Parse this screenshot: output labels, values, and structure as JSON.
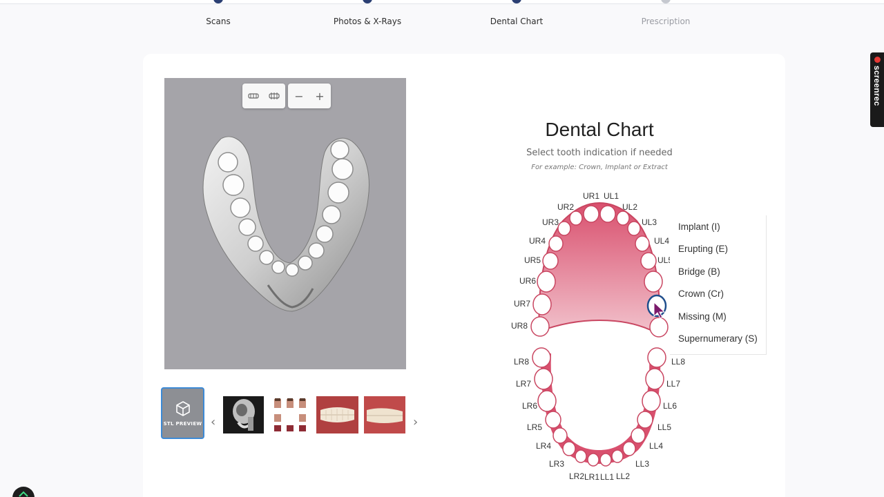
{
  "steps": [
    {
      "label": "Scans",
      "state": "active"
    },
    {
      "label": "Photos & X-Rays",
      "state": "active"
    },
    {
      "label": "Dental Chart",
      "state": "active"
    },
    {
      "label": "Prescription",
      "state": "inactive"
    }
  ],
  "viewer": {
    "tools": [
      "upper-jaw-icon",
      "lower-jaw-icon",
      "zoom-out-icon",
      "zoom-in-icon"
    ],
    "zoom_out": "−",
    "zoom_in": "+"
  },
  "thumbnails": {
    "stl_label": "STL PREVIEW",
    "prev": "‹",
    "next": "›"
  },
  "chart": {
    "title": "Dental Chart",
    "subtitle": "Select tooth indication if needed",
    "example": "For example: Crown, Implant or Extract"
  },
  "teeth": {
    "upper": [
      "UR1",
      "UL1",
      "UR2",
      "UL2",
      "UR3",
      "UL3",
      "UR4",
      "UL4",
      "UR5",
      "UL5",
      "UR6",
      "UR7",
      "UR8"
    ],
    "lower": [
      "LR8",
      "LL8",
      "LR7",
      "LL7",
      "LR6",
      "LL6",
      "LR5",
      "LL5",
      "LR4",
      "LL4",
      "LR3",
      "LL3",
      "LR2",
      "LR1",
      "LL1",
      "LL2"
    ]
  },
  "menu": {
    "items": [
      "Implant (I)",
      "Erupting (E)",
      "Bridge (B)",
      "Crown (Cr)",
      "Missing (M)",
      "Supernumerary (S)"
    ]
  },
  "recorder": {
    "label": "screenrec"
  },
  "colors": {
    "gum": "#d9506e",
    "gum_light": "#f4c8d2",
    "step_active": "#2b3f73",
    "step_inactive": "#c5c8cf",
    "selected_outline": "#1f4e8c",
    "stl_border": "#3c8ad6"
  }
}
